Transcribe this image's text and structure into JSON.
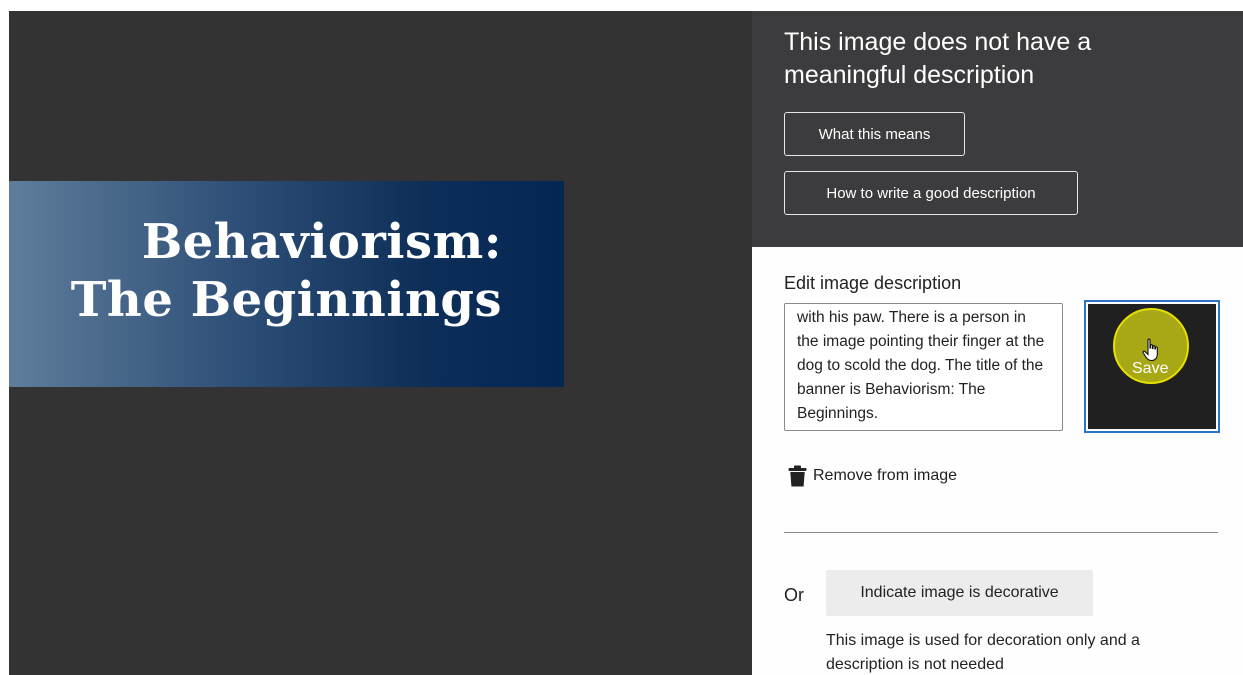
{
  "preview": {
    "banner_title_line1": "Behaviorism:",
    "banner_title_line2": "The Beginnings"
  },
  "panel": {
    "heading": "This image does not have a meaningful description",
    "what_button": "What this means",
    "how_button": "How to write a good description",
    "edit_label": "Edit image description",
    "description_text": "A small dog is sitting on the floor looking ashamed and hiding his face with his paw. There is a person in the image pointing their finger at the dog to scold the dog. The title of the banner is Behaviorism: The Beginnings.",
    "save_button": "Save",
    "remove_label": "Remove from image",
    "or_label": "Or",
    "decorative_button": "Indicate image is decorative",
    "decorative_help": "This image is used for decoration only and a description is not needed"
  },
  "icons": {
    "trash": "trash-icon",
    "cursor": "hand-pointer-icon"
  },
  "colors": {
    "panel_header_bg": "#3c3c3e",
    "focus_outline": "#2e73c8",
    "cursor_highlight": "#e6e000",
    "banner_gradient_start": "#5f7d9b",
    "banner_gradient_end": "#042653"
  }
}
